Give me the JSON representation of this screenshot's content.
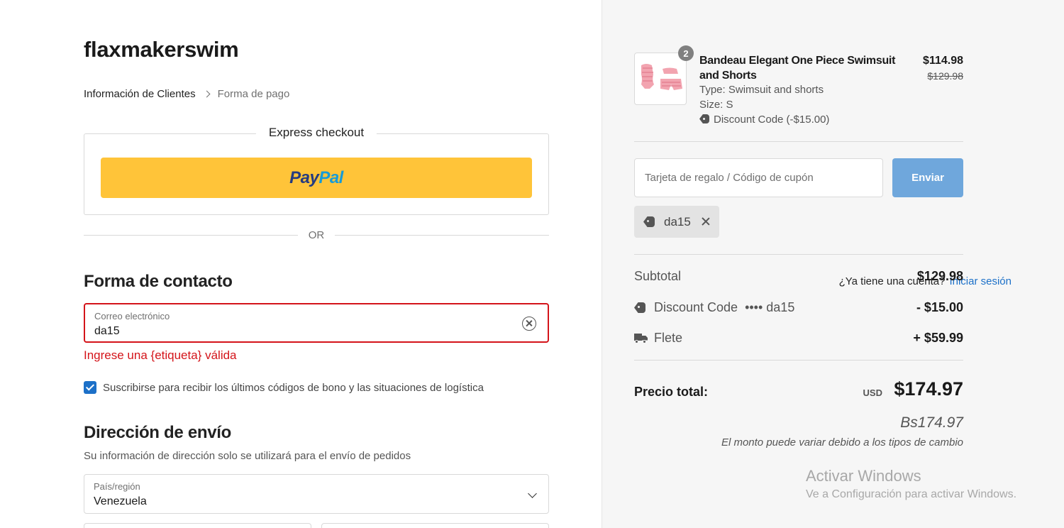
{
  "store": {
    "name": "flaxmakerswim"
  },
  "breadcrumb": {
    "step1": "Información de Clientes",
    "step2": "Forma de pago"
  },
  "express": {
    "title": "Express checkout",
    "paypal_pay": "Pay",
    "paypal_pal": "Pal"
  },
  "divider": {
    "or": "OR"
  },
  "contact": {
    "title": "Forma de contacto",
    "account_question": "¿Ya tiene una cuenta?",
    "login_link": "Iniciar sesión",
    "email_label": "Correo electrónico",
    "email_value": "da15",
    "error": "Ingrese una {etiqueta} válida",
    "newsletter_checked": true,
    "newsletter_label": "Suscribirse para recibir los últimos códigos de bono y las situaciones de logística"
  },
  "shipping": {
    "title": "Dirección de envío",
    "subtitle": "Su información de dirección solo se utilizará para el envío de pedidos",
    "country_label": "País/región",
    "country_value": "Venezuela"
  },
  "cart": {
    "item": {
      "quantity": "2",
      "name": "Bandeau Elegant One Piece Swimsuit and Shorts",
      "type": "Type: Swimsuit and shorts",
      "size": "Size: S",
      "discount": "Discount Code (-$15.00)",
      "price": "$114.98",
      "old_price": "$129.98"
    },
    "coupon_placeholder": "Tarjeta de regalo / Código de cupón",
    "send_button": "Enviar",
    "applied_code": "da15"
  },
  "summary": {
    "subtotal_label": "Subtotal",
    "subtotal_value": "$129.98",
    "discount_label": "Discount Code",
    "discount_code": "•••• da15",
    "discount_value": "- $15.00",
    "shipping_label": "Flete",
    "shipping_value": "+ $59.99",
    "total_label": "Precio total:",
    "currency": "USD",
    "total_value": "$174.97",
    "alt_total": "Bs174.97",
    "note": "El monto puede variar debido a los tipos de cambio"
  },
  "watermark": {
    "title": "Activar Windows",
    "subtitle": "Ve a Configuración para activar Windows."
  },
  "colors": {
    "accent": "#1c70c8",
    "error": "#d4141a",
    "paypal": "#ffc439",
    "send_button": "#6fa7dc"
  }
}
